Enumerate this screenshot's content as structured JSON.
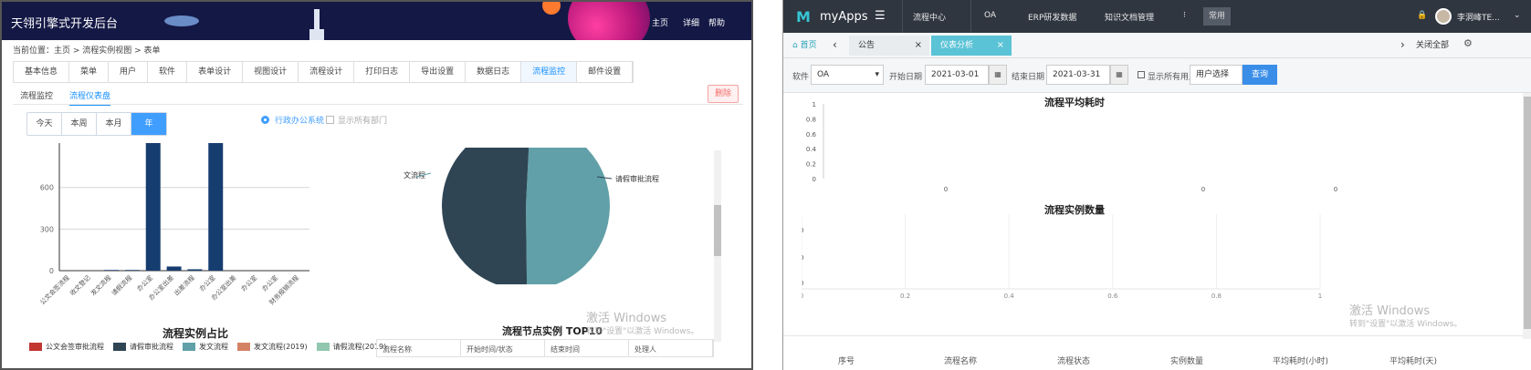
{
  "left": {
    "header": {
      "title": "天翎引擎式开发后台",
      "nav": [
        "主页",
        "详细",
        "帮助"
      ]
    },
    "breadcrumb": "当前位置：主页 > 流程实例视图 > 表单",
    "tabs": [
      "基本信息",
      "菜单",
      "用户",
      "软件",
      "表单设计",
      "视图设计",
      "流程设计",
      "打印日志",
      "导出设置",
      "数据日志",
      "流程监控",
      "邮件设置"
    ],
    "active_tab_index": 10,
    "subtabs": [
      "流程监控",
      "流程仪表盘"
    ],
    "active_subtab_index": 1,
    "delete_label": "删除",
    "segments": [
      "今天",
      "本周",
      "本月",
      "年"
    ],
    "active_segment_index": 3,
    "radio_label": "行政办公系统",
    "checkbox_label": "显示所有部门",
    "chart_title": "流程实例占比",
    "top10_title": "流程节点实例 TOP10",
    "top10_row": [
      "流程名称",
      "开始时间/状态",
      "结束时间",
      "处理人"
    ],
    "watermark_title": "激活 Windows",
    "watermark_sub": "转到\"设置\"以激活 Windows。"
  },
  "chart_data": [
    {
      "type": "bar",
      "categories": [
        "公文会签流程",
        "收文登记",
        "发文流程",
        "请假流程",
        "办公室",
        "办公室出差",
        "出差流程",
        "办公室",
        "办公室出差",
        "办公室",
        "办公室",
        "财务报销流程"
      ],
      "values": [
        0,
        0,
        5,
        5,
        920,
        30,
        10,
        920,
        0,
        0,
        0,
        0
      ],
      "yticks": [
        0,
        300,
        600
      ],
      "ylim": [
        0,
        920
      ],
      "legend": [
        {
          "name": "公文会签审批流程",
          "color": "#c23531"
        },
        {
          "name": "请假审批流程",
          "color": "#2f4554"
        },
        {
          "name": "发文流程",
          "color": "#61a0a8"
        },
        {
          "name": "发文流程(2019)",
          "color": "#d48265"
        },
        {
          "name": "请假流程(2019)",
          "color": "#91c7ae"
        }
      ]
    },
    {
      "type": "pie",
      "series": [
        {
          "name": "发文流程",
          "value": 49,
          "color": "#61a0a8"
        },
        {
          "name": "请假审批流程",
          "value": 51,
          "color": "#2f4554"
        }
      ]
    },
    {
      "type": "line",
      "title": "流程平均耗时",
      "yticks": [
        0,
        0.2,
        0.4,
        0.6,
        0.8,
        1
      ],
      "points": [
        0,
        0,
        0
      ]
    },
    {
      "type": "line",
      "title": "流程实例数量",
      "xticks": [
        0,
        0.2,
        0.4,
        0.6,
        0.8,
        1
      ]
    }
  ],
  "right": {
    "header": {
      "logo": "M",
      "app_name": "myApps",
      "nav": [
        "流程中心",
        "OA",
        "ERP研发数据",
        "知识文档管理"
      ],
      "more": "⁝",
      "gray_btn": "常用",
      "user": "李洞峰TE..."
    },
    "tabs": {
      "home": "首页",
      "tab1": "公告",
      "tab2": "仪表分析",
      "close_all": "关闭全部"
    },
    "filter": {
      "software_label": "软件",
      "software_value": "OA",
      "start_label": "开始日期",
      "start_value": "2021-03-01",
      "end_label": "结束日期",
      "end_value": "2021-03-31",
      "show_users_label": "显示所有用户",
      "user_select": "用户选择",
      "query_label": "查询"
    },
    "chart1_title": "流程平均耗时",
    "chart2_title": "流程实例数量",
    "table_headers": [
      "序号",
      "流程名称",
      "流程状态",
      "实例数量",
      "平均耗时(小时)",
      "平均耗时(天)"
    ],
    "watermark_title": "激活 Windows",
    "watermark_sub": "转到\"设置\"以激活 Windows。"
  }
}
